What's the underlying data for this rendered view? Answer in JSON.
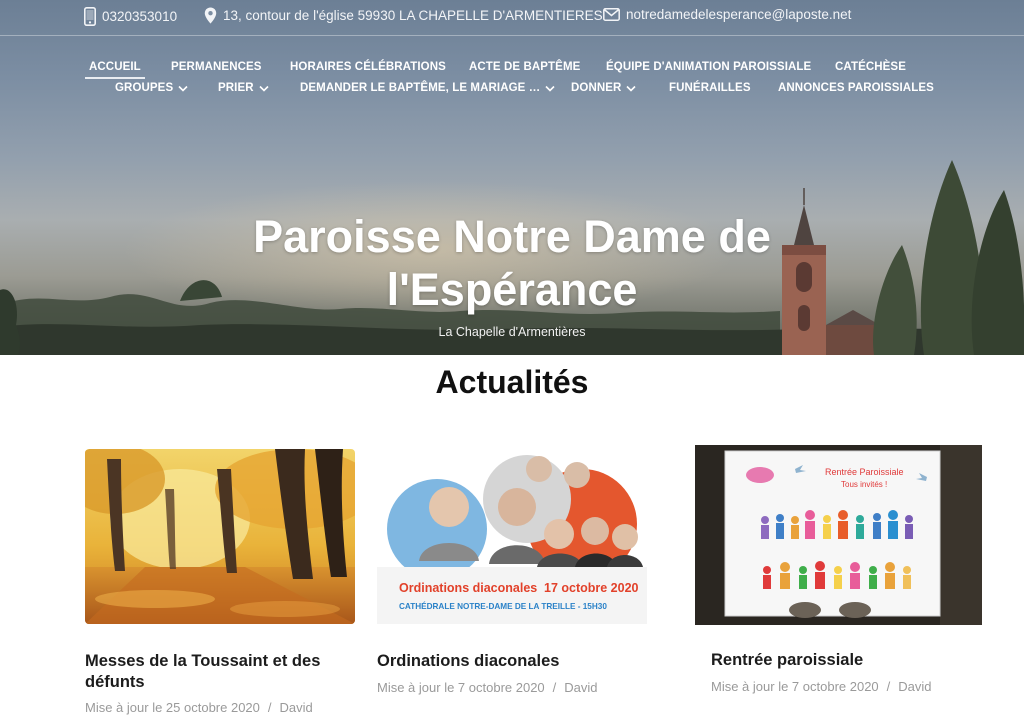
{
  "header": {
    "phone": "0320353010",
    "address": "13, contour de l'église 59930 LA CHAPELLE D'ARMENTIERES",
    "email": "notredamedelesperance@laposte.net"
  },
  "nav": {
    "row1": [
      {
        "label": "ACCUEIL",
        "active": true
      },
      {
        "label": "PERMANENCES"
      },
      {
        "label": "HORAIRES CÉLÉBRATIONS"
      },
      {
        "label": "ACTE DE BAPTÊME"
      },
      {
        "label": "ÉQUIPE D'ANIMATION PAROISSIALE"
      },
      {
        "label": "CATÉCHÈSE"
      }
    ],
    "row2": [
      {
        "label": "GROUPES",
        "has_dropdown": true
      },
      {
        "label": "PRIER",
        "has_dropdown": true
      },
      {
        "label": "DEMANDER LE BAPTÊME, LE MARIAGE …",
        "has_dropdown": true
      },
      {
        "label": "DONNER",
        "has_dropdown": true
      },
      {
        "label": "FUNÉRAILLES"
      },
      {
        "label": "ANNONCES PAROISSIALES"
      }
    ]
  },
  "hero": {
    "title": "Paroisse Notre Dame de l'Espérance",
    "tagline": "La Chapelle d'Armentières"
  },
  "news": {
    "heading": "Actualités",
    "posts": [
      {
        "title": "Messes de la Toussaint et des défunts",
        "updated": "Mise à jour le 25 octobre 2020",
        "author": "David"
      },
      {
        "title": "Ordinations diaconales",
        "updated": "Mise à jour le 7 octobre 2020",
        "author": "David",
        "image_text": {
          "headline": "Ordinations diaconales",
          "date": "17 octobre 2020",
          "subline": "CATHÉDRALE NOTRE-DAME DE LA TREILLE - 15H30"
        }
      },
      {
        "title": "Rentrée paroissiale",
        "updated": "Mise à jour le 7 octobre 2020",
        "author": "David",
        "image_text": {
          "line1": "Rentrée Paroissiale",
          "line2": "Tous invités !"
        }
      }
    ],
    "separator": "/"
  },
  "icons": {
    "phone": "phone-icon",
    "address": "map-pin-icon",
    "email": "envelope-icon",
    "dropdown": "chevron-down-icon"
  },
  "colors": {
    "title": "#111111",
    "meta": "#9a9a9a",
    "nav_text": "#ffffff",
    "date_red": "#e2412a",
    "subline_blue": "#2b82c8"
  }
}
